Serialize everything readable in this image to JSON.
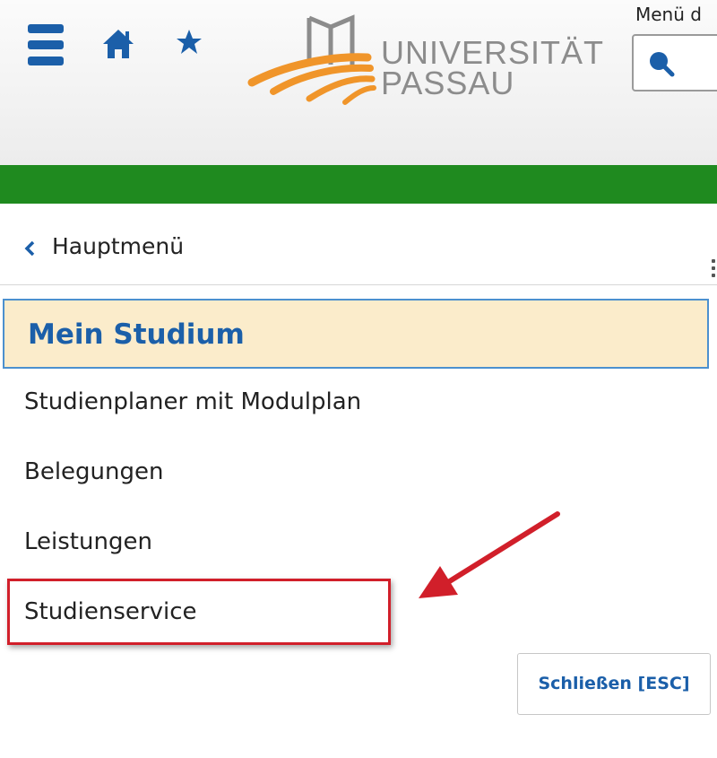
{
  "header": {
    "logo_line1": "UNIVERSITÄT",
    "logo_line2": "PASSAU",
    "menu_label": "Menü d",
    "icons": [
      "menu-icon",
      "home-icon",
      "star-icon",
      "search-icon"
    ]
  },
  "colors": {
    "accent_blue": "#1b5fa9",
    "green_bar": "#1f8a1f",
    "logo_orange": "#f0952a",
    "active_bg": "#fbeccb",
    "highlight_red": "#d11f2a"
  },
  "nav": {
    "back_label": "Hauptmenü",
    "active_item": "Mein Studium",
    "items": [
      "Studienplaner mit Modulplan",
      "Belegungen",
      "Leistungen",
      "Studienservice"
    ]
  },
  "close_label": "Schließen [ESC]"
}
